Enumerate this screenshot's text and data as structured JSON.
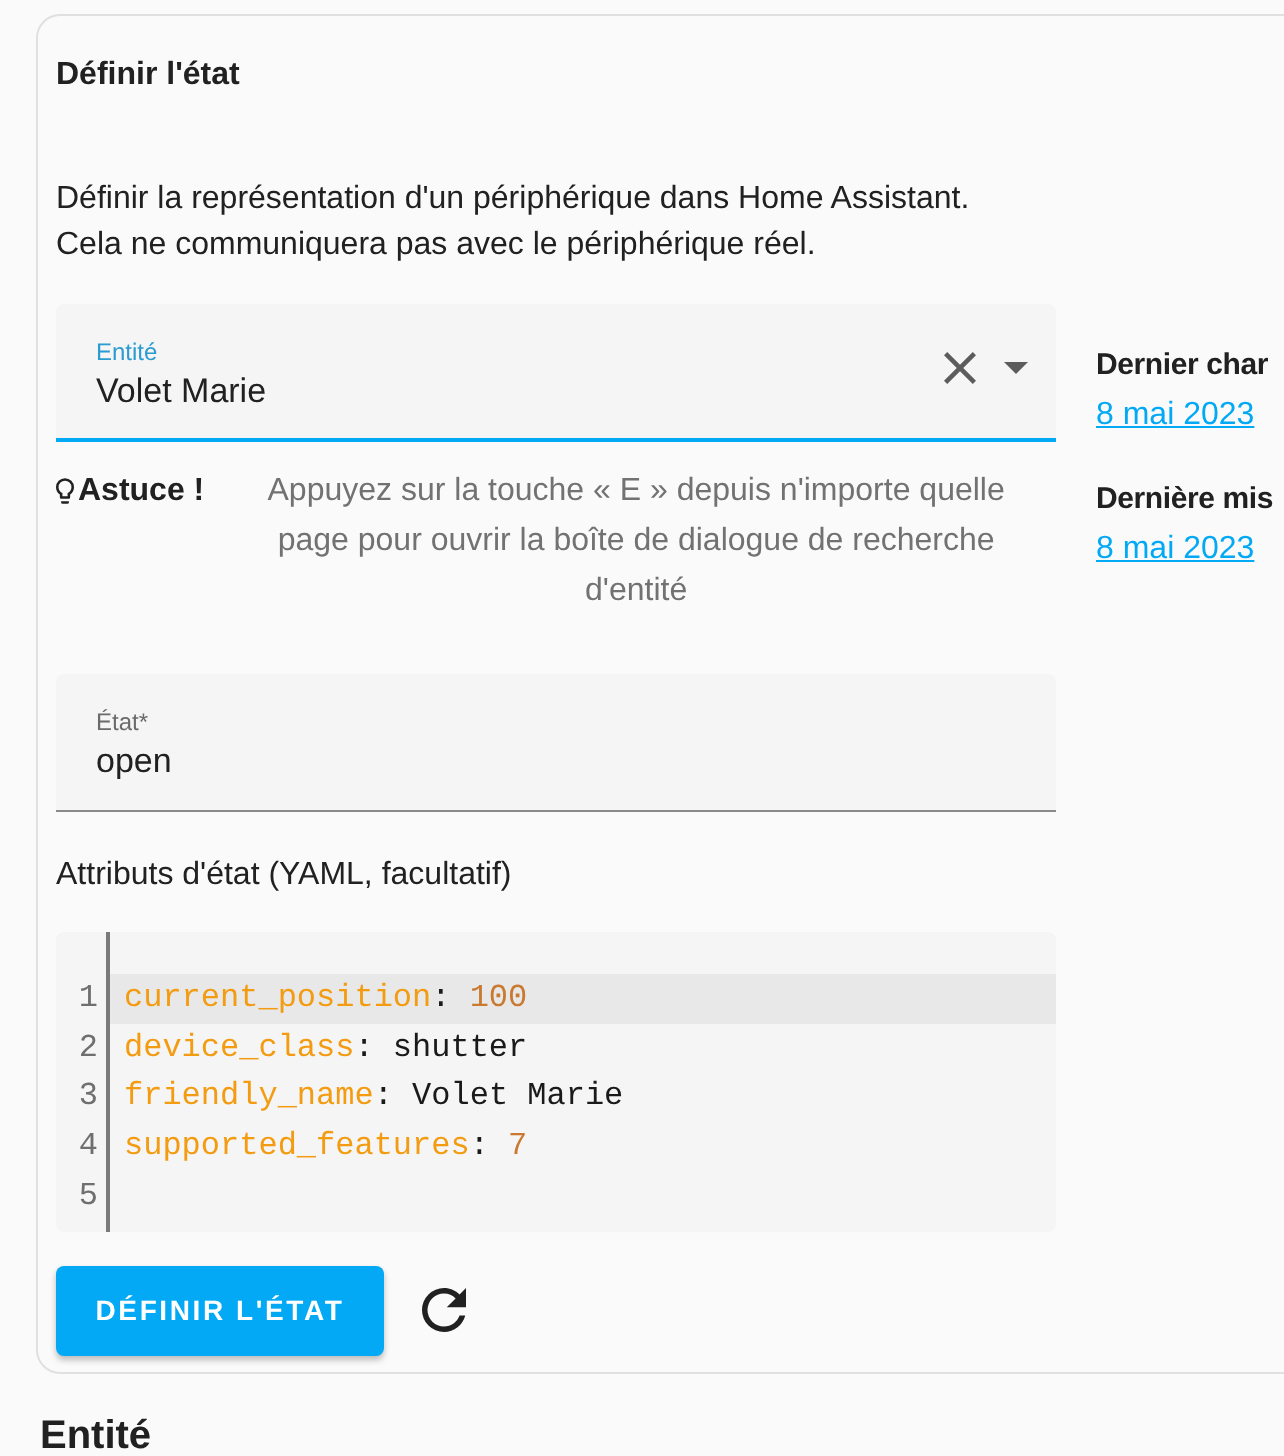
{
  "card": {
    "title": "Définir l'état",
    "description": "Définir la représentation d'un périphérique dans Home Assistant.\nCela ne communiquera pas avec le périphérique réel."
  },
  "entity_field": {
    "label": "Entité",
    "value": "Volet Marie",
    "focused": true
  },
  "tip": {
    "label": "Astuce !",
    "text": "Appuyez sur la touche « E » depuis n'importe quelle page pour ouvrir la boîte de dialogue de recherche d'entité"
  },
  "state_field": {
    "label": "État*",
    "value": "open",
    "focused": false
  },
  "attributes_label": "Attributs d'état (YAML, facultatif)",
  "editor": {
    "lines": [
      {
        "number": "1",
        "active": true,
        "tokens": [
          {
            "kind": "key",
            "text": "current_position"
          },
          {
            "kind": "plain",
            "text": ": "
          },
          {
            "kind": "number",
            "text": "100"
          }
        ]
      },
      {
        "number": "2",
        "active": false,
        "tokens": [
          {
            "kind": "key",
            "text": "device_class"
          },
          {
            "kind": "plain",
            "text": ": shutter"
          }
        ]
      },
      {
        "number": "3",
        "active": false,
        "tokens": [
          {
            "kind": "key",
            "text": "friendly_name"
          },
          {
            "kind": "plain",
            "text": ": Volet Marie"
          }
        ]
      },
      {
        "number": "4",
        "active": false,
        "tokens": [
          {
            "kind": "key",
            "text": "supported_features"
          },
          {
            "kind": "plain",
            "text": ": "
          },
          {
            "kind": "number",
            "text": "7"
          }
        ]
      },
      {
        "number": "5",
        "active": false
      }
    ]
  },
  "actions": {
    "submit": "DÉFINIR L'ÉTAT"
  },
  "side_info": [
    {
      "label": "Dernier char",
      "value": "8 mai 2023"
    },
    {
      "label": "Dernière mis",
      "value": "8 mai 2023"
    }
  ],
  "section_heading": "Entité"
}
